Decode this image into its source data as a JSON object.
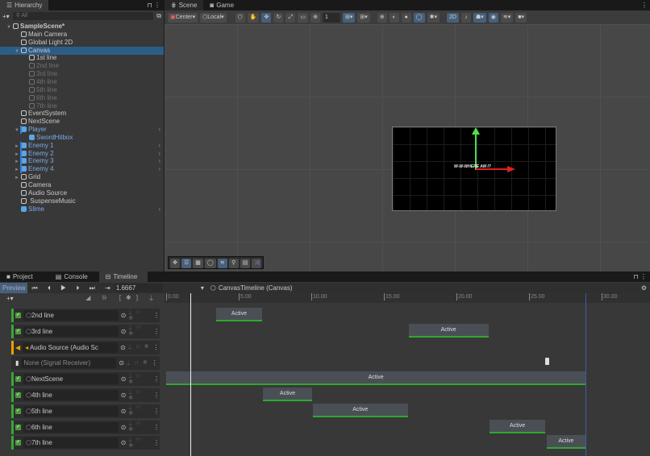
{
  "hierarchy": {
    "tab": "Hierarchy",
    "search_placeholder": "All",
    "items": [
      {
        "label": "SampleScene*",
        "depth": 0,
        "style": "scene",
        "arrow": "▼"
      },
      {
        "label": "Main Camera",
        "depth": 1
      },
      {
        "label": "Global Light 2D",
        "depth": 1
      },
      {
        "label": "Canvas",
        "depth": 1,
        "style": "sel",
        "arrow": "▼"
      },
      {
        "label": "1st line",
        "depth": 2
      },
      {
        "label": "2nd line",
        "depth": 2,
        "style": "dim"
      },
      {
        "label": "3rd line",
        "depth": 2,
        "style": "dim"
      },
      {
        "label": "4th line",
        "depth": 2,
        "style": "dim"
      },
      {
        "label": "5th line",
        "depth": 2,
        "style": "dim"
      },
      {
        "label": "6th line",
        "depth": 2,
        "style": "dim"
      },
      {
        "label": "7th line",
        "depth": 2,
        "style": "dim"
      },
      {
        "label": "EventSystem",
        "depth": 1
      },
      {
        "label": "NextScene",
        "depth": 1
      },
      {
        "label": "Player",
        "depth": 1,
        "style": "blue",
        "arrow": "▼",
        "chev": true,
        "bar": true
      },
      {
        "label": "SwordHitbox",
        "depth": 2,
        "style": "blue"
      },
      {
        "label": "Enemy 1",
        "depth": 1,
        "style": "blue",
        "arrow": "►",
        "chev": true,
        "bar": true
      },
      {
        "label": "Enemy 2",
        "depth": 1,
        "style": "blue",
        "arrow": "►",
        "chev": true,
        "bar": true
      },
      {
        "label": "Enemy 3",
        "depth": 1,
        "style": "blue",
        "arrow": "►",
        "chev": true,
        "bar": true
      },
      {
        "label": "Enemy 4",
        "depth": 1,
        "style": "blue",
        "arrow": "►",
        "chev": true,
        "bar": true
      },
      {
        "label": "Grid",
        "depth": 1,
        "arrow": "►"
      },
      {
        "label": "Camera",
        "depth": 1
      },
      {
        "label": "Audio Source",
        "depth": 1
      },
      {
        "label": " SuspenseMusic",
        "depth": 1
      },
      {
        "label": "Slime",
        "depth": 1,
        "style": "blue",
        "chev": true
      }
    ]
  },
  "scene": {
    "tabs": [
      "Scene",
      "Game"
    ],
    "pivot": "Center",
    "space": "Local",
    "snap_value": "1",
    "mode_2d": "2D",
    "game_text": "W-W-WHERE AM I?"
  },
  "bottom": {
    "tabs": [
      "Project",
      "Console",
      "Timeline"
    ]
  },
  "timeline": {
    "preview": "Preview",
    "time": "1.6667",
    "asset": "CanvasTimeline (Canvas)",
    "playhead": 1.6667,
    "end": 28.9,
    "ticks": [
      "0.00",
      "5.00",
      "10.00",
      "15.00",
      "20.00",
      "25.00",
      "30.00"
    ],
    "tracks": [
      {
        "name": "2nd line",
        "type": "activation",
        "clips": [
          {
            "start": 3.45,
            "end": 6.6,
            "label": "Active"
          }
        ]
      },
      {
        "name": "3rd line",
        "type": "activation",
        "clips": [
          {
            "start": 16.7,
            "end": 22.2,
            "label": "Active"
          }
        ]
      },
      {
        "name": "Audio Source (Audio Sc",
        "type": "audio",
        "clips": []
      },
      {
        "name": "None (Signal Receiver)",
        "type": "signal",
        "clips": [],
        "marker": 26.2
      },
      {
        "name": "NextScene",
        "type": "activation",
        "clips": [
          {
            "start": 0,
            "end": 28.9,
            "label": "Active"
          }
        ]
      },
      {
        "name": "4th line",
        "type": "activation",
        "clips": [
          {
            "start": 6.67,
            "end": 10.05,
            "label": "Active"
          }
        ]
      },
      {
        "name": "5th line",
        "type": "activation",
        "clips": [
          {
            "start": 10.1,
            "end": 16.65,
            "label": "Active"
          }
        ]
      },
      {
        "name": "6th line",
        "type": "activation",
        "clips": [
          {
            "start": 22.3,
            "end": 26.1,
            "label": "Active"
          }
        ]
      },
      {
        "name": "7th line",
        "type": "activation",
        "clips": [
          {
            "start": 26.2,
            "end": 28.9,
            "label": "Active"
          }
        ]
      }
    ]
  },
  "colors": {
    "selection": "#2c5d87",
    "prefab": "#7aaae8",
    "clip_bar": "#2fa82f",
    "audio": "#e8a200"
  }
}
